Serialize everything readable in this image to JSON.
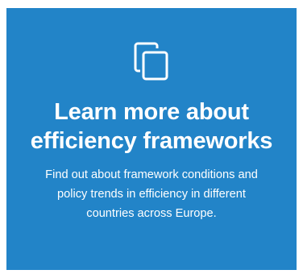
{
  "card": {
    "background_color": "#2284c8",
    "text_color": "#ffffff",
    "icon": "copy-icon",
    "title_line1": "Learn more about",
    "title_line2": "efficiency frameworks",
    "description_line1": "Find out about framework conditions and",
    "description_line2": "policy trends in efficiency in different",
    "description_line3": "countries across Europe."
  }
}
